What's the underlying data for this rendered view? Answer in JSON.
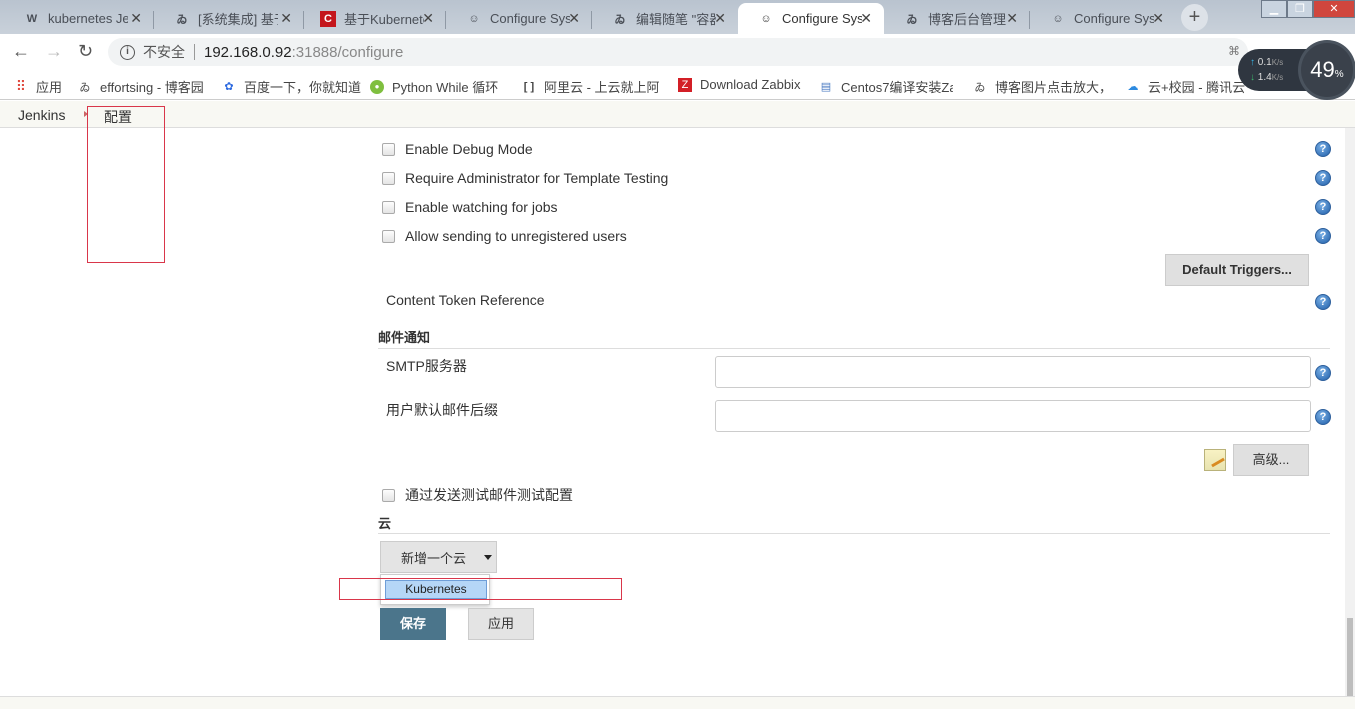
{
  "browser": {
    "tabs": [
      {
        "title": "kubernetes Jen",
        "icon": "W",
        "icon_name": "w-site-icon"
      },
      {
        "title": "[系统集成] 基于",
        "icon": "ゐ",
        "icon_name": "cnblogs-icon"
      },
      {
        "title": "基于Kubernete",
        "icon": "C",
        "icon_name": "csdn-icon"
      },
      {
        "title": "Configure Sys",
        "icon": "☺",
        "icon_name": "jenkins-icon"
      },
      {
        "title": "编辑随笔 \"容器",
        "icon": "ゐ",
        "icon_name": "cnblogs-icon"
      },
      {
        "title": "Configure Sys",
        "icon": "☺",
        "icon_name": "jenkins-icon",
        "active": true
      },
      {
        "title": "博客后台管理",
        "icon": "ゐ",
        "icon_name": "cnblogs-icon"
      },
      {
        "title": "Configure Sys",
        "icon": "☺",
        "icon_name": "jenkins-icon"
      }
    ],
    "new_tab_label": "+",
    "close_glyph": "✕",
    "address": {
      "security_label": "不安全",
      "host": "192.168.0.92",
      "path": ":31888/configure"
    },
    "bookmarks": [
      {
        "label": "应用",
        "icon_name": "apps-grid-icon"
      },
      {
        "label": "effortsing - 博客园",
        "icon_name": "cnblogs-icon"
      },
      {
        "label": "百度一下，你就知道",
        "icon_name": "baidu-paw-icon"
      },
      {
        "label": "Python While 循环",
        "icon_name": "runoob-icon"
      },
      {
        "label": "阿里云 - 上云就上阿",
        "icon_name": "aliyun-icon"
      },
      {
        "label": "Download Zabbix",
        "icon_name": "zabbix-icon"
      },
      {
        "label": "Centos7编译安装Za",
        "icon_name": "doc-icon"
      },
      {
        "label": "博客图片点击放大，",
        "icon_name": "cnblogs-icon"
      },
      {
        "label": "云+校园 - 腾讯云",
        "icon_name": "tencent-cloud-icon"
      }
    ],
    "net_widget": {
      "upload": "0.1",
      "download": "1.4",
      "unit": "K/s",
      "percent": "49",
      "percent_sign": "%"
    }
  },
  "breadcrumb": {
    "root": "Jenkins",
    "current": "配置"
  },
  "form": {
    "checkboxes": [
      {
        "label": "Enable Debug Mode",
        "checked": false
      },
      {
        "label": "Require Administrator for Template Testing",
        "checked": false
      },
      {
        "label": "Enable watching for jobs",
        "checked": false
      },
      {
        "label": "Allow sending to unregistered users",
        "checked": false
      }
    ],
    "default_triggers_label": "Default Triggers...",
    "content_token_label": "Content Token Reference",
    "email_section_title": "邮件通知",
    "smtp_label": "SMTP服务器",
    "smtp_value": "",
    "suffix_label": "用户默认邮件后缀",
    "suffix_value": "",
    "advanced_label": "高级...",
    "test_email_label": "通过发送测试邮件测试配置",
    "cloud_section_title": "云",
    "add_cloud_label": "新增一个云",
    "add_cloud_options": [
      "Kubernetes"
    ],
    "save_label": "保存",
    "apply_label": "应用",
    "help_glyph": "?"
  }
}
